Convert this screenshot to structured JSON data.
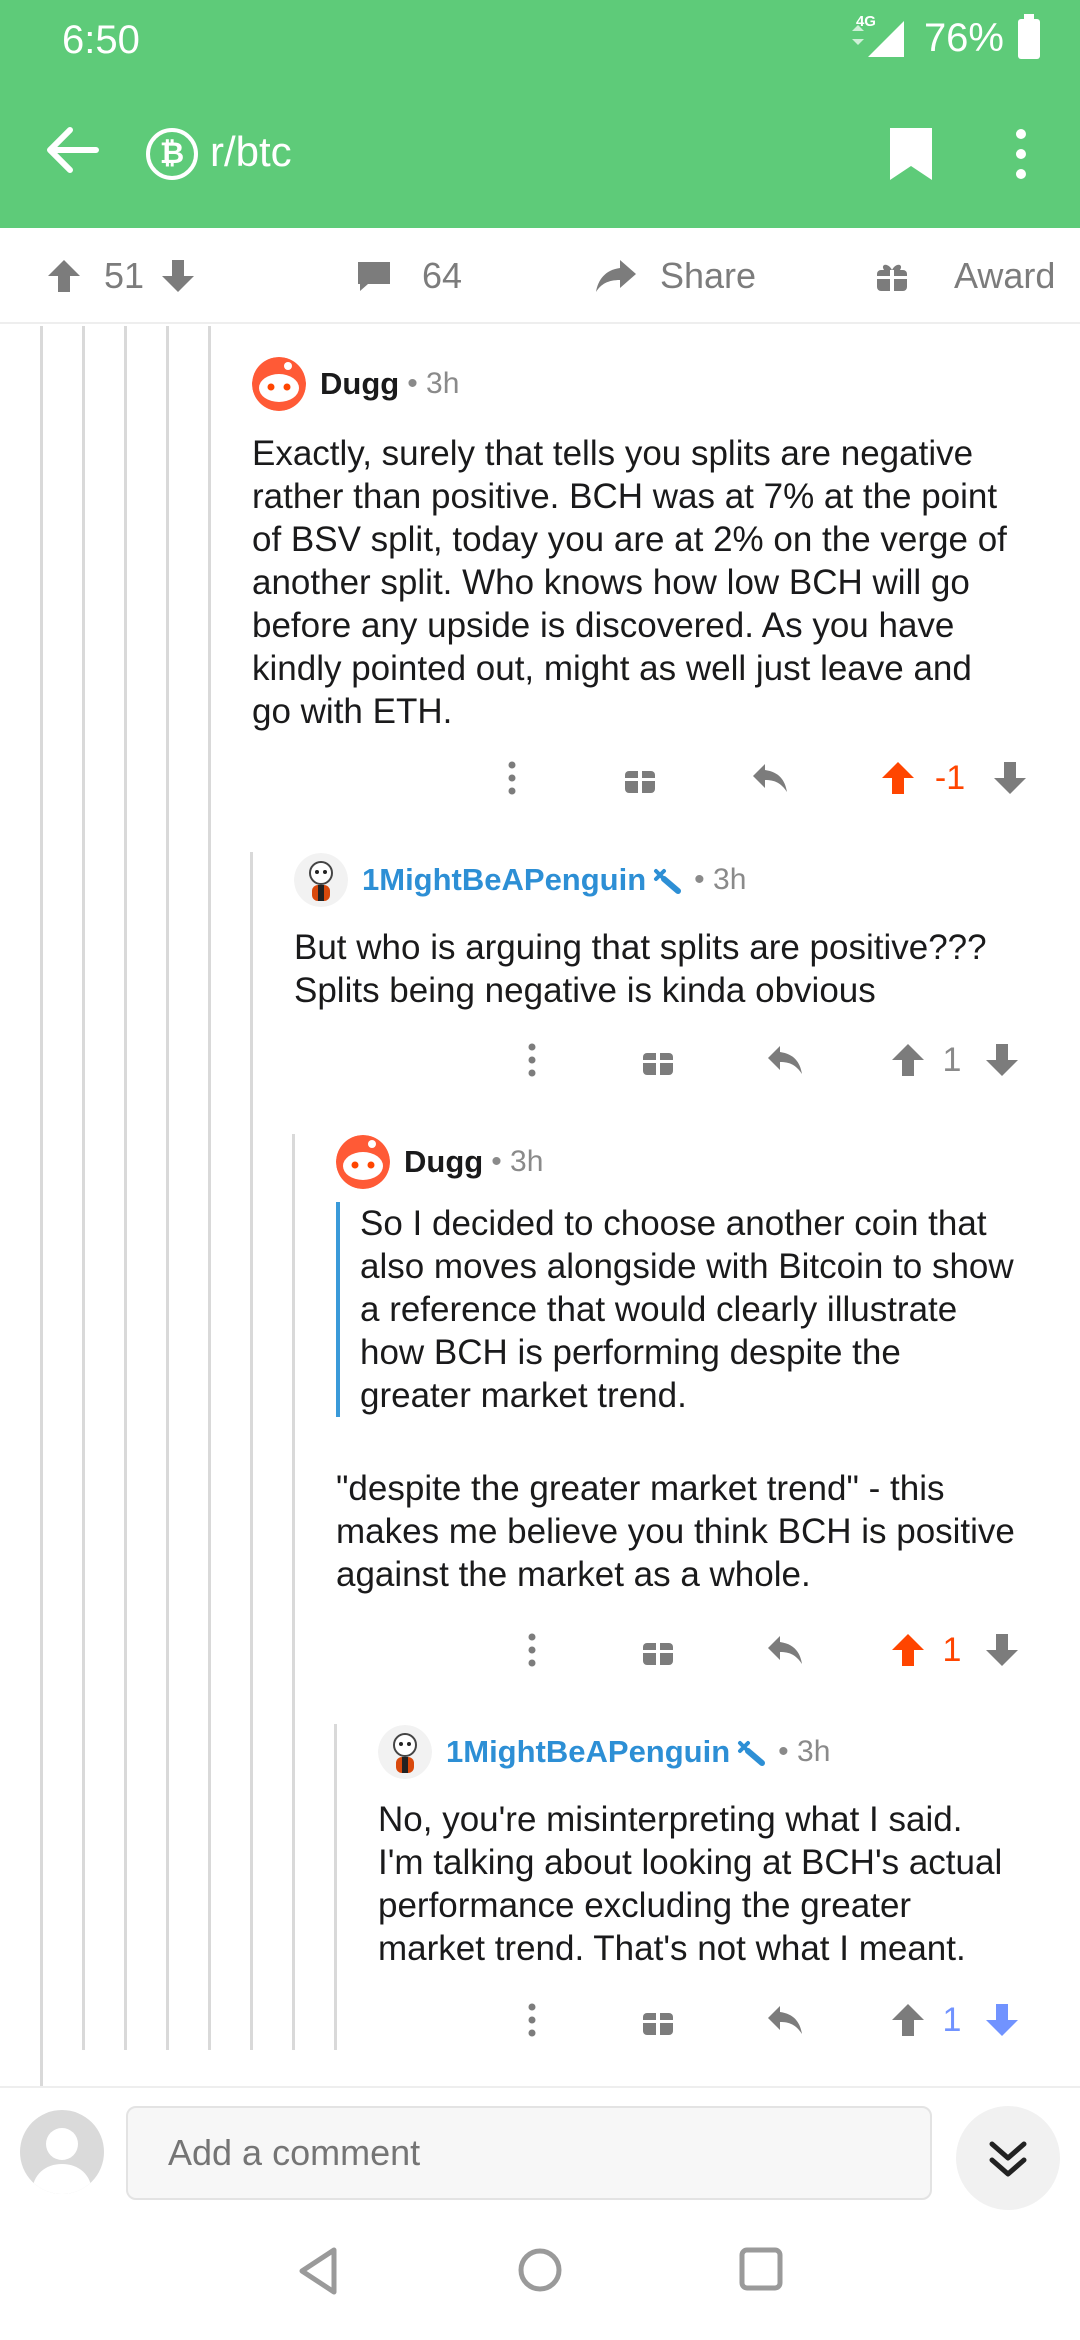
{
  "status": {
    "time": "6:50",
    "network": "4G",
    "battery": "76%"
  },
  "header": {
    "subreddit": "r/btc",
    "subreddit_icon": "bitcoin-icon"
  },
  "post_actions": {
    "upvotes": "51",
    "comments": "64",
    "share": "Share",
    "award": "Award"
  },
  "comments": [
    {
      "author": "Dugg",
      "time": "3h",
      "body_lines": [
        "Exactly, surely that tells you splits are negative",
        "rather than positive. BCH was at 7% at the point",
        "of BSV split, today you are at 2% on the verge of",
        "another split. Who knows how low BCH will go",
        "before any upside is discovered. As you have",
        "kindly pointed out, might as well just leave and",
        "go with ETH."
      ],
      "score": "-1",
      "vote": "up"
    },
    {
      "author": "1MightBeAPenguin",
      "time": "3h",
      "body_lines": [
        "But who is arguing that splits are positive???",
        "Splits being negative is kinda obvious"
      ],
      "score": "1",
      "vote": "none"
    },
    {
      "author": "Dugg",
      "time": "3h",
      "quote_lines": [
        "So I decided to choose another coin that",
        "also moves alongside with Bitcoin to show",
        "a reference that would clearly illustrate",
        "how BCH is performing despite the",
        "greater market trend."
      ],
      "body_lines": [
        "\"despite the greater market trend\" - this",
        "makes me believe you think BCH is positive",
        "against the market as a whole."
      ],
      "score": "1",
      "vote": "up"
    },
    {
      "author": "1MightBeAPenguin",
      "time": "3h",
      "body_lines": [
        "No, you're misinterpreting what I said.",
        "I'm talking about looking at BCH's actual",
        "performance excluding the greater",
        "market trend. That's not what I meant."
      ],
      "score": "1",
      "vote": "down"
    }
  ],
  "composer": {
    "placeholder": "Add a comment"
  },
  "colors": {
    "header_green": "#5ecb79",
    "upvote": "#ff4500",
    "downvote": "#7193ff",
    "op_blue": "#2d8fd5"
  }
}
